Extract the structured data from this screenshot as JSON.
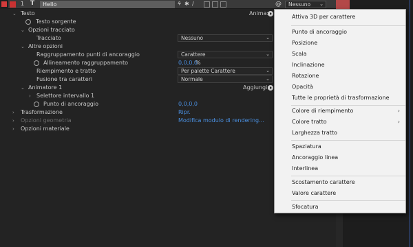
{
  "layer": {
    "number": "1",
    "type_glyph": "T",
    "name": "Hello",
    "switches": [
      "⚘",
      "✱",
      "/"
    ],
    "spiral_glyph": "@",
    "parent_value": "Nessuno",
    "chevron": "⌄"
  },
  "props": {
    "testo": "Testo",
    "anima_label": "Anima:",
    "testo_sorgente": "Testo sorgente",
    "opzioni_tracciato": "Opzioni tracciato",
    "tracciato": "Tracciato",
    "tracciato_value": "Nessuno",
    "altre_opzioni": "Altre opzioni",
    "raggruppamento": "Raggruppamento punti di ancoraggio",
    "raggruppamento_value": "Carattere",
    "allineamento": "Allineamento raggruppamento",
    "allineamento_value": "0,0,0,0",
    "allineamento_unit": "%",
    "riempimento": "Riempimento e tratto",
    "riempimento_value": "Per palette Carattere",
    "fusione": "Fusione tra caratteri",
    "fusione_value": "Normale",
    "animatore": "Animatore 1",
    "aggiungi_label": "Aggiungi:",
    "selettore": "Selettore intervallo 1",
    "punto_ancoraggio": "Punto di ancoraggio",
    "punto_value": "0,0,0,0",
    "trasformazione": "Trasformazione",
    "trasformazione_value": "Ripr.",
    "opzioni_geometria": "Opzioni geometria",
    "geometria_value": "Modifica modulo di rendering...",
    "opzioni_materiale": "Opzioni materiale",
    "twirl_open": "⌄",
    "twirl_closed": "›",
    "dd_chevron": "⌄"
  },
  "menu": {
    "items": [
      "Attiva 3D per carattere",
      "Punto di ancoraggio",
      "Posizione",
      "Scala",
      "Inclinazione",
      "Rotazione",
      "Opacità",
      "Tutte le proprietà di trasformazione",
      "Colore di riempimento",
      "Colore tratto",
      "Larghezza tratto",
      "Spaziatura",
      "Ancoraggio linea",
      "Interlinea",
      "Scostamento carattere",
      "Valore carattere",
      "Sfocatura"
    ],
    "submenu_arrow": "›"
  },
  "colors": {
    "accent_blue": "#4a8fe0",
    "layer_label_red": "#c83232",
    "menu_bg": "#f2f2f2",
    "panel_bg": "#232323"
  }
}
